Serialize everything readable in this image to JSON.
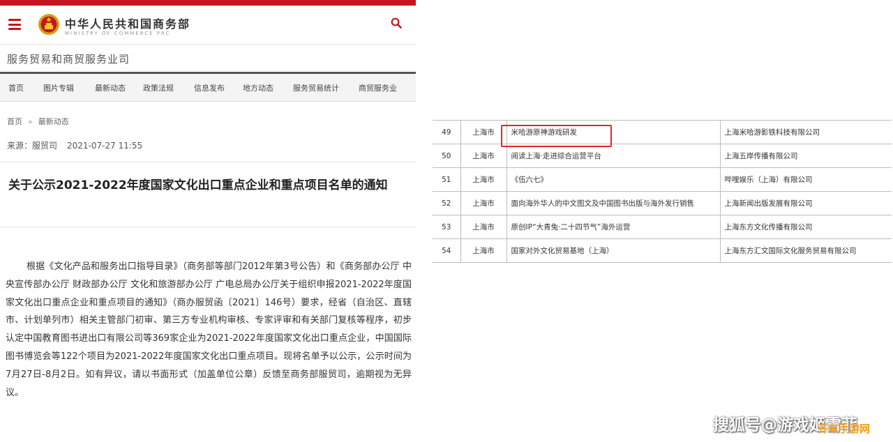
{
  "header": {
    "site_name": "中华人民共和国商务部",
    "site_name_en": "MINISTRY OF COMMERCE PRC"
  },
  "department": {
    "name": "服务贸易和商贸服务业司"
  },
  "nav": {
    "items": [
      "首页",
      "图片专辑",
      "最新动态",
      "政策法规",
      "信息发布",
      "地方动态",
      "服务贸易统计",
      "商贸服务业"
    ]
  },
  "breadcrumb": {
    "home": "首页",
    "separator": "»",
    "current": "最新动态"
  },
  "article_meta": {
    "source": "来源：服贸司",
    "datetime": "2021-07-27 11:55"
  },
  "article": {
    "title": "关于公示2021-2022年度国家文化出口重点企业和重点项目名单的通知",
    "body": "根据《文化产品和服务出口指导目录》（商务部等部门2012年第3号公告）和《商务部办公厅 中央宣传部办公厅 财政部办公厅 文化和旅游部办公厅 广电总局办公厅关于组织申报2021-2022年度国家文化出口重点企业和重点项目的通知》（商办服贸函〔2021〕146号）要求，经省（自治区、直辖市、计划单列市）相关主管部门初审、第三方专业机构审核、专家评审和有关部门复核等程序，初步认定中国教育图书进出口有限公司等369家企业为2021-2022年度国家文化出口重点企业，中国国际图书博览会等122个项目为2021-2022年度国家文化出口重点项目。现将名单予以公示，公示时间为7月27日-8月2日。如有异议，请以书面形式（加盖单位公章）反馈至商务部服贸司，逾期视为无异议。"
  },
  "table": {
    "rows": [
      {
        "num": "49",
        "city": "上海市",
        "project": "米哈游原神游戏研发",
        "company": "上海米哈游影铁科技有限公司"
      },
      {
        "num": "50",
        "city": "上海市",
        "project": "阅读上海·走进综合运营平台",
        "company": "上海五岸传播有限公司"
      },
      {
        "num": "51",
        "city": "上海市",
        "project": "《伍六七》",
        "company": "哔哩娱乐（上海）有限公司"
      },
      {
        "num": "52",
        "city": "上海市",
        "project": "面向海外华人的中文图文及中国图书出版与海外发行销售",
        "company": "上海新闻出版发展有限公司"
      },
      {
        "num": "53",
        "city": "上海市",
        "project": "原创IP“大青兔·二十四节气”海外运营",
        "company": "上海东方文化传播有限公司"
      },
      {
        "num": "54",
        "city": "上海市",
        "project": "国家对外文化贸易基地（上海）",
        "company": "上海东方汇文国际文化服务贸易有限公司"
      }
    ]
  },
  "watermarks": {
    "sohu": "搜狐号@游戏姬雪菲",
    "site": "齐车手游网"
  },
  "colors": {
    "brand_red": "#c4161c",
    "highlight_red": "#e0262b",
    "watermark_orange": "#f39c12"
  }
}
